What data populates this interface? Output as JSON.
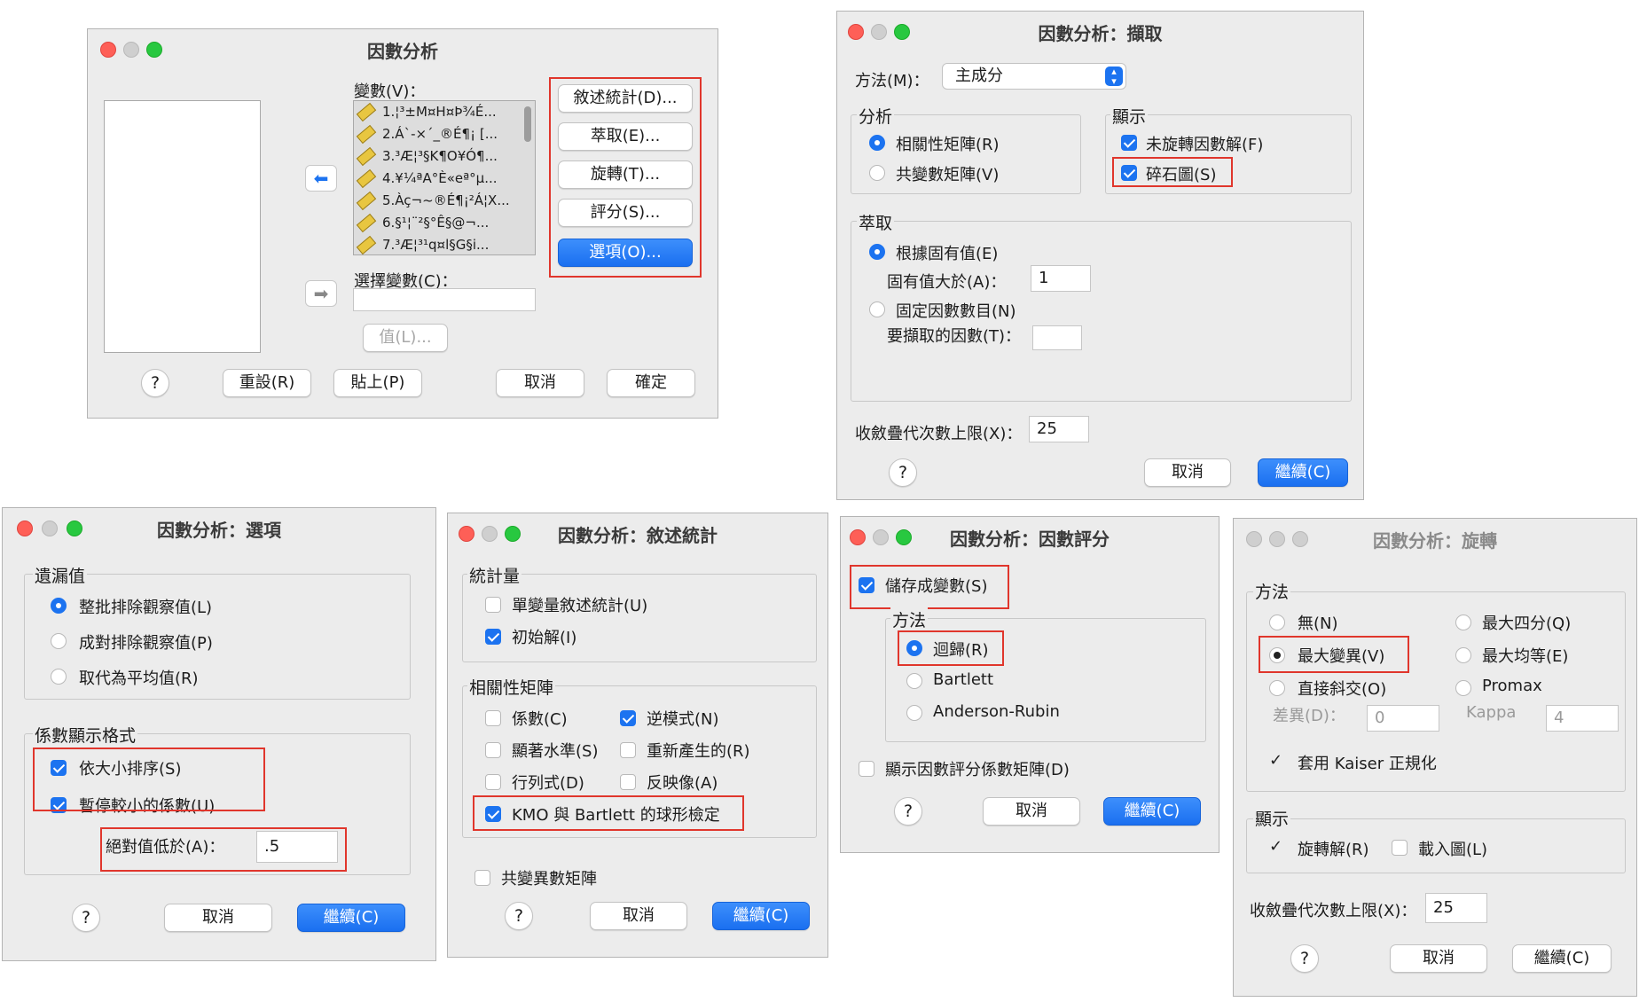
{
  "main": {
    "title": "因數分析",
    "variables_label": "變數(V)：",
    "variables": [
      "1.¦³±M¤H¤Þ¾É...",
      "2.Á`-×´_®É¶¡ [...",
      "3.³Æ¦³§K¶O¥Ó¶...",
      "4.¥¼ªA°È«eª°µ...",
      "5.Àç¬~®É¶¡²Á¦X...",
      "6.§¹¦¨²§°Ê§@¬...",
      "7.³Æ¦³¹q¤l§G§i..."
    ],
    "selection_label": "選擇變數(C)：",
    "value_button": "值(L)...",
    "side_buttons": [
      "敘述統計(D)...",
      "萃取(E)...",
      "旋轉(T)...",
      "評分(S)...",
      "選項(O)..."
    ],
    "help": "?",
    "reset": "重設(R)",
    "paste": "貼上(P)",
    "cancel": "取消",
    "ok": "確定"
  },
  "extract": {
    "title": "因數分析：擷取",
    "method_label": "方法(M)：",
    "method_value": "主成分",
    "analysis_label": "分析",
    "corr": "相關性矩陣(R)",
    "cov": "共變數矩陣(V)",
    "display_label": "顯示",
    "unrotated": "未旋轉因數解(F)",
    "scree": "碎石圖(S)",
    "extract_label": "萃取",
    "eigen": "根據固有值(E)",
    "eigen_gt": "固有值大於(A)：",
    "eigen_value": "1",
    "fixed": "固定因數數目(N)",
    "factors_to": "要擷取的因數(T)：",
    "maxiter_label": "收斂疊代次數上限(X)：",
    "maxiter": "25",
    "help": "?",
    "cancel": "取消",
    "continue": "繼續(C)"
  },
  "options": {
    "title": "因數分析：選項",
    "missing_label": "遺漏值",
    "listwise": "整批排除觀察值(L)",
    "pairwise": "成對排除觀察值(P)",
    "mean": "取代為平均值(R)",
    "format_label": "係數顯示格式",
    "sort": "依大小排序(S)",
    "suppress": "暫停較小的係數(U)",
    "abs_label": "絕對值低於(A)：",
    "abs_value": ".5",
    "help": "?",
    "cancel": "取消",
    "continue": "繼續(C)"
  },
  "descriptives": {
    "title": "因數分析：敘述統計",
    "stats_label": "統計量",
    "univariate": "單變量敘述統計(U)",
    "initial": "初始解(I)",
    "corr_label": "相關性矩陣",
    "coeff": "係數(C)",
    "inverse": "逆模式(N)",
    "sig": "顯著水準(S)",
    "reproduced": "重新產生的(R)",
    "det": "行列式(D)",
    "antiimage": "反映像(A)",
    "kmo": "KMO 與 Bartlett 的球形檢定",
    "covmatrix": "共變異數矩陣",
    "help": "?",
    "cancel": "取消",
    "continue": "繼續(C)"
  },
  "scores": {
    "title": "因數分析：因數評分",
    "save": "儲存成變數(S)",
    "method_label": "方法",
    "regression": "迴歸(R)",
    "bartlett": "Bartlett",
    "anderson": "Anderson-Rubin",
    "display_matrix": "顯示因數評分係數矩陣(D)",
    "help": "?",
    "cancel": "取消",
    "continue": "繼續(C)"
  },
  "rotation": {
    "title": "因數分析：旋轉",
    "method_label": "方法",
    "none": "無(N)",
    "quartimax": "最大四分(Q)",
    "varimax": "最大變異(V)",
    "equamax": "最大均等(E)",
    "oblimin": "直接斜交(O)",
    "promax": "Promax",
    "delta_label": "差異(D)：",
    "delta": "0",
    "kappa_label": "Kappa",
    "kappa": "4",
    "kaiser": "套用 Kaiser 正規化",
    "display_label": "顯示",
    "rotated": "旋轉解(R)",
    "loading": "載入圖(L)",
    "maxiter_label": "收斂疊代次數上限(X)：",
    "maxiter": "25",
    "help": "?",
    "cancel": "取消",
    "continue": "繼續(C)"
  }
}
